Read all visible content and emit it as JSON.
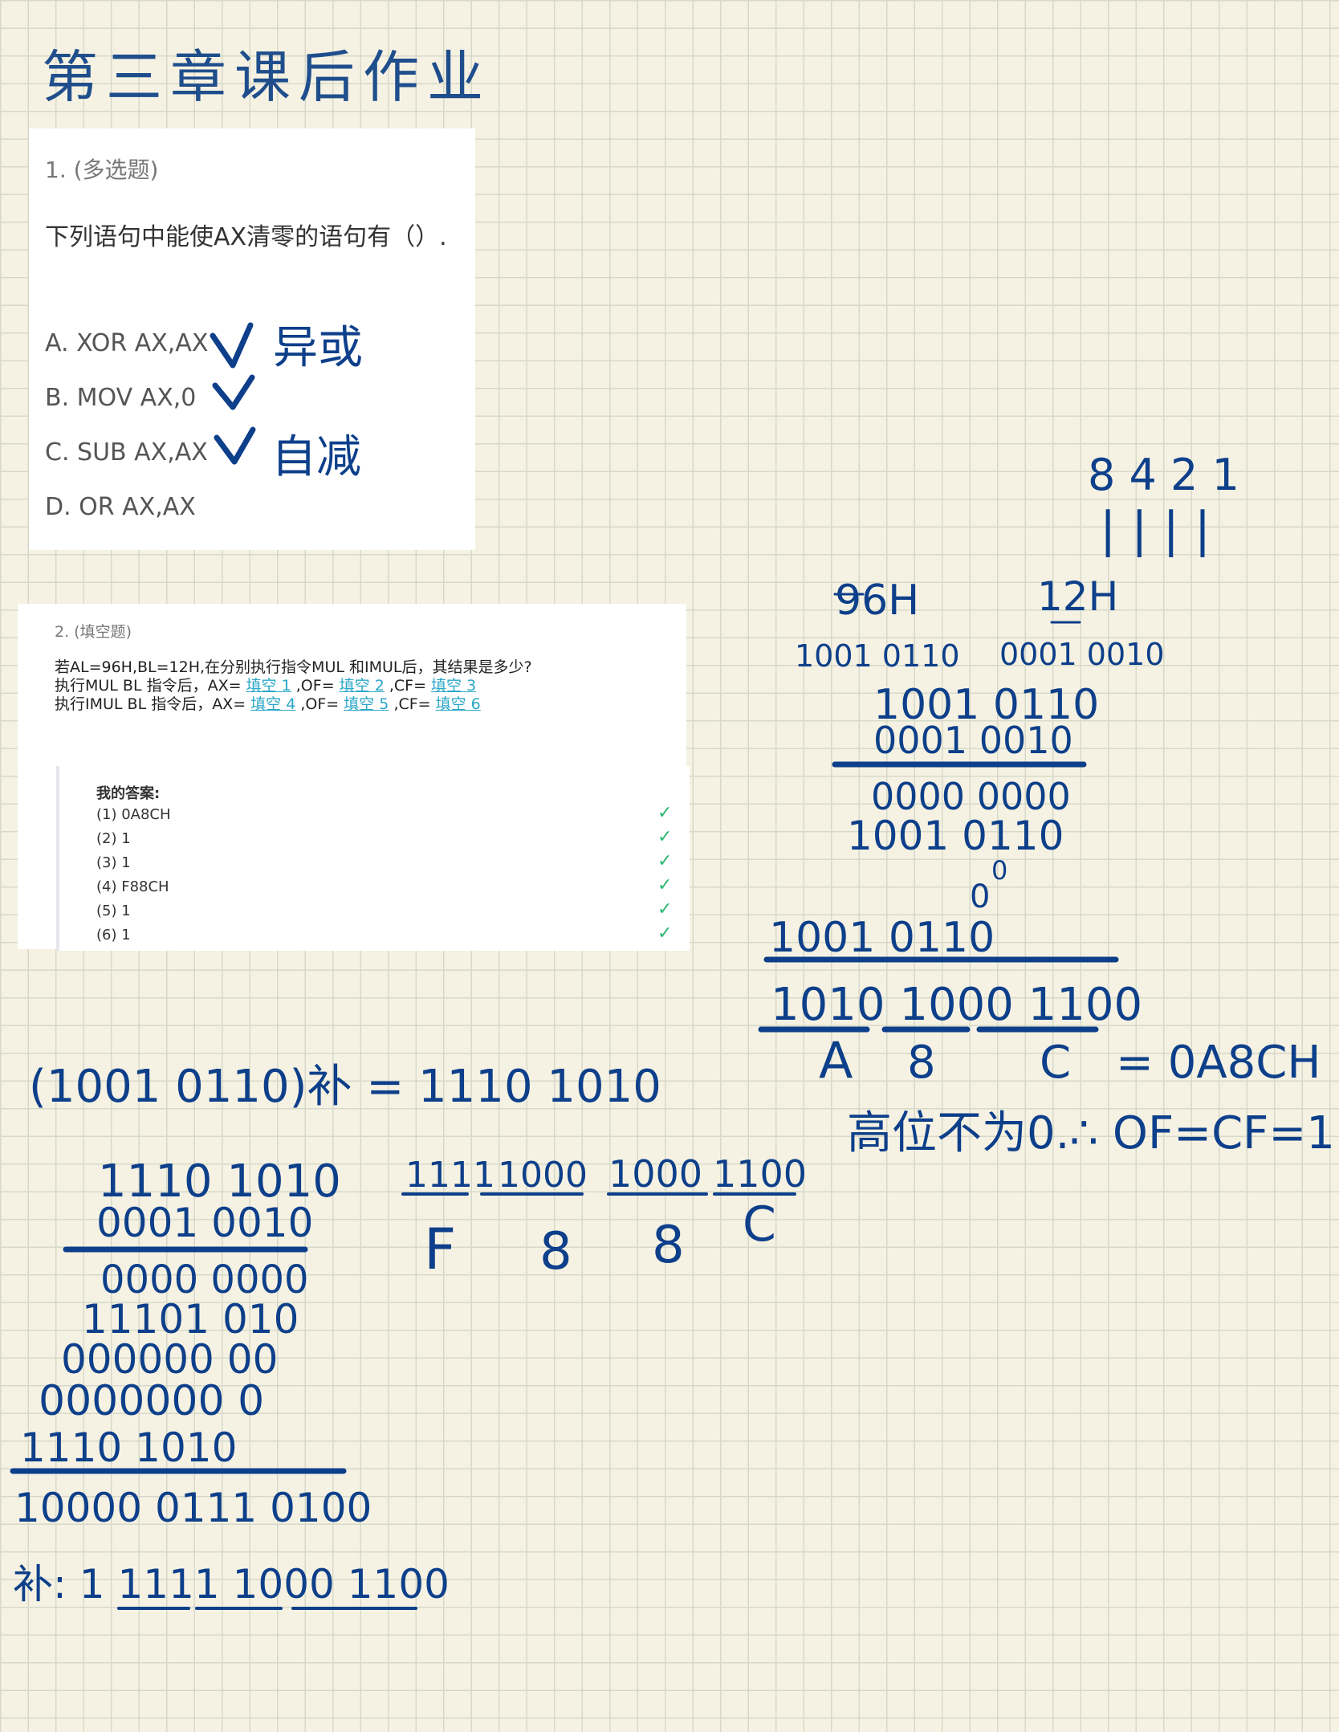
{
  "title": "第三章课后作业",
  "q1": {
    "number": "1. (多选题)",
    "question": "下列语句中能使AX清零的语句有（）.",
    "options": [
      "A. XOR AX,AX",
      "B.  MOV AX,0",
      "C. SUB AX,AX",
      "D. OR AX,AX"
    ],
    "notes": {
      "a": "异或",
      "c": "自减"
    }
  },
  "q2": {
    "number": "2. (填空题)",
    "line1": "若AL=96H,BL=12H,在分别执行指令MUL 和IMUL后，其结果是多少?",
    "line2_prefix": "执行MUL BL  指令后，AX=",
    "line3_prefix": "执行IMUL BL  指令后，AX=",
    "of": ",OF=",
    "cf": ",CF=",
    "blanks": [
      "填空 1",
      "填空 2",
      "填空 3",
      "填空 4",
      "填空 5",
      "填空 6"
    ],
    "my_answers_label": "我的答案:",
    "answers": [
      "(1) 0A8CH",
      "(2) 1",
      "(3) 1",
      "(4) F88CH",
      "(5) 1",
      "(6) 1"
    ],
    "check_icon": "✓"
  },
  "handwriting": {
    "n8421": "8 4 2 1",
    "ones": "| | | |",
    "h96": "96H",
    "h12": "12H",
    "b96": "1001  0110",
    "b12": "0001  0010",
    "m1": "1001 0110",
    "m2": "0001 0010",
    "p1": "0000 0000",
    "p2": "1001 0110",
    "p3": "0",
    "p4": "0",
    "p5": "1001 0110",
    "res": "1010 1000 1100",
    "hexA": "A",
    "hex8": "8",
    "hexC": "C",
    "eq": "= 0A8CH",
    "note": "高位不为0.∴ OF=CF=1",
    "comp": "(1001 0110)补 = 1110 1010",
    "l1": "1110 1010",
    "l2": "0001 0010",
    "l3": "0000 0000",
    "l4": "11101 010",
    "l5": "000000 00",
    "l6": "0000000 0",
    "l7": "1110 1010",
    "l8": "10000 0111 0100",
    "l9": "补: 1 1111 1000 1100",
    "hx1": "1111",
    "hx2": "1000",
    "hx3": "1000",
    "hx4": "1100",
    "hxF": "F",
    "hx8a": "8",
    "hx8b": "8",
    "hxC": "C"
  }
}
